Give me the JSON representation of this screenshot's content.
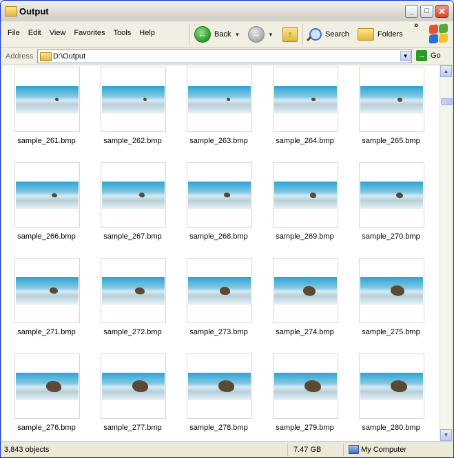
{
  "window": {
    "title": "Output"
  },
  "menu": [
    "File",
    "Edit",
    "View",
    "Favorites",
    "Tools",
    "Help"
  ],
  "toolbar": {
    "back": "Back",
    "search": "Search",
    "folders": "Folders"
  },
  "address": {
    "label": "Address",
    "path": "D:\\Output",
    "go": "Go"
  },
  "files": [
    "sample_261.bmp",
    "sample_262.bmp",
    "sample_263.bmp",
    "sample_264.bmp",
    "sample_265.bmp",
    "sample_266.bmp",
    "sample_267.bmp",
    "sample_268.bmp",
    "sample_269.bmp",
    "sample_270.bmp",
    "sample_271.bmp",
    "sample_272.bmp",
    "sample_273.bmp",
    "sample_274.bmp",
    "sample_275.bmp",
    "sample_276.bmp",
    "sample_277.bmp",
    "sample_278.bmp",
    "sample_279.bmp",
    "sample_280.bmp"
  ],
  "status": {
    "objects": "3,843 objects",
    "size": "7.47 GB",
    "location": "My Computer"
  },
  "colors": {
    "titlebar_border": "#0831d9",
    "sky": "#2ea3d3",
    "close_button": "#d4452b"
  }
}
